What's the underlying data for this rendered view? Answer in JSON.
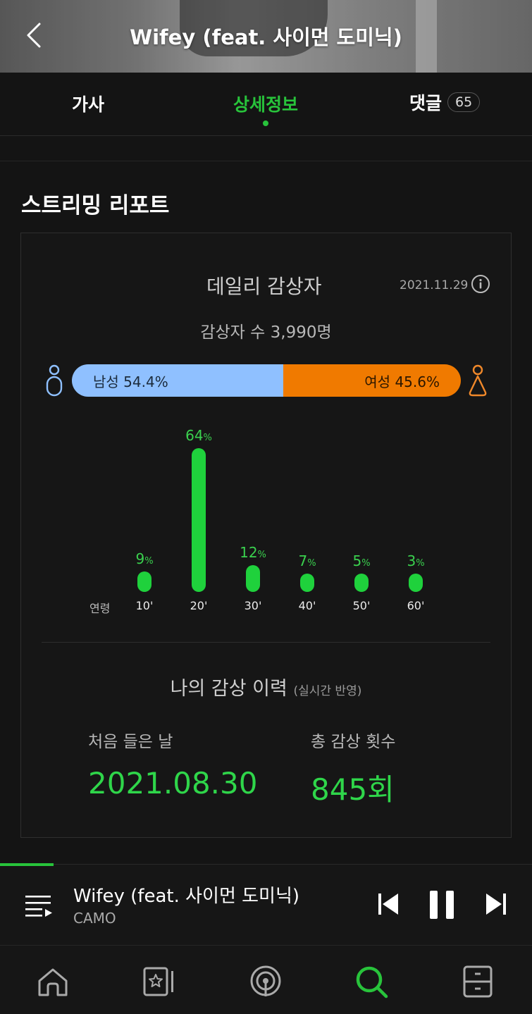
{
  "header": {
    "title": "Wifey (feat. 사이먼 도미닉)"
  },
  "tabs": {
    "lyrics": "가사",
    "detail": "상세정보",
    "comments": "댓글",
    "comments_count": "65",
    "active": "detail"
  },
  "section": {
    "title": "스트리밍 리포트"
  },
  "daily": {
    "title": "데일리 감상자",
    "date": "2021.11.29",
    "listeners": "감상자 수 3,990명",
    "male_label": "남성 54.4%",
    "female_label": "여성 45.6%",
    "male_share": 0.544,
    "colors": {
      "male": "#8fc0ff",
      "female": "#f07a00",
      "bar": "#1fd13c",
      "accent": "#28c33b"
    }
  },
  "chart_data": {
    "type": "bar",
    "xlabel": "연령",
    "categories": [
      "10'",
      "20'",
      "30'",
      "40'",
      "50'",
      "60'"
    ],
    "values": [
      9,
      64,
      12,
      7,
      5,
      3
    ],
    "unit": "%"
  },
  "history": {
    "title": "나의 감상 이력",
    "subtitle": "(실시간 반영)",
    "first_label": "처음 들은 날",
    "first_value": "2021.08.30",
    "count_label": "총 감상 횟수",
    "count_value": "845회"
  },
  "player": {
    "title": "Wifey (feat. 사이먼 도미닉)",
    "artist": "CAMO",
    "progress": 0.1
  },
  "nav": {
    "items": [
      "home-icon",
      "music-library-icon",
      "podcast-icon",
      "search-icon",
      "drawer-icon"
    ],
    "active": "search-icon"
  }
}
